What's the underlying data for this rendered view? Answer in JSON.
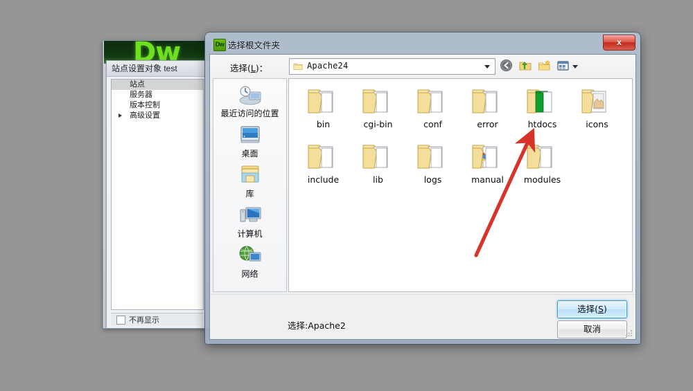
{
  "background_window": {
    "splash_logo": "Dw",
    "dialog_title": "站点设置对象 test",
    "items": [
      {
        "label": "站点",
        "selected": true,
        "expandable": false
      },
      {
        "label": "服务器",
        "selected": false,
        "expandable": false
      },
      {
        "label": "版本控制",
        "selected": false,
        "expandable": false
      },
      {
        "label": "高级设置",
        "selected": false,
        "expandable": true
      }
    ],
    "footer_checkbox_label": "不再显示"
  },
  "dialog": {
    "app_icon": "Dw",
    "title": "选择根文件夹",
    "close_label": "x",
    "select_label": "选择(L)：",
    "path_value": "Apache24",
    "toolbar": [
      {
        "name": "back-icon",
        "title": "后退"
      },
      {
        "name": "up-folder-icon",
        "title": "向上"
      },
      {
        "name": "new-folder-icon",
        "title": "新建文件夹"
      },
      {
        "name": "views-icon",
        "title": "视图"
      }
    ],
    "places": [
      {
        "label": "最近访问的位置",
        "icon": "recent-places-icon"
      },
      {
        "label": "桌面",
        "icon": "desktop-icon"
      },
      {
        "label": "库",
        "icon": "libraries-icon"
      },
      {
        "label": "计算机",
        "icon": "computer-icon"
      },
      {
        "label": "网络",
        "icon": "network-icon"
      }
    ],
    "folders_row1": [
      {
        "label": "bin",
        "variant": "plain"
      },
      {
        "label": "cgi-bin",
        "variant": "plain"
      },
      {
        "label": "conf",
        "variant": "plain"
      },
      {
        "label": "error",
        "variant": "plain"
      },
      {
        "label": "htdocs",
        "variant": "green"
      },
      {
        "label": "icons",
        "variant": "image"
      }
    ],
    "folders_row2": [
      {
        "label": "include",
        "variant": "plain"
      },
      {
        "label": "lib",
        "variant": "plain"
      },
      {
        "label": "logs",
        "variant": "plain"
      },
      {
        "label": "manual",
        "variant": "color"
      },
      {
        "label": "modules",
        "variant": "plain"
      }
    ],
    "result_label": "选择:Apache2",
    "buttons": {
      "confirm": "选择(S)",
      "confirm_accel": "S",
      "cancel": "取消"
    }
  },
  "annotation": {
    "arrow_color": "#d8332a",
    "points_to": "htdocs"
  },
  "colors": {
    "desktop": "#969696",
    "accent_blue": "#3c9ad9",
    "close_red": "#c32a1c",
    "folder_yellow": "#f5e6a8",
    "dw_green": "#6fe020"
  }
}
